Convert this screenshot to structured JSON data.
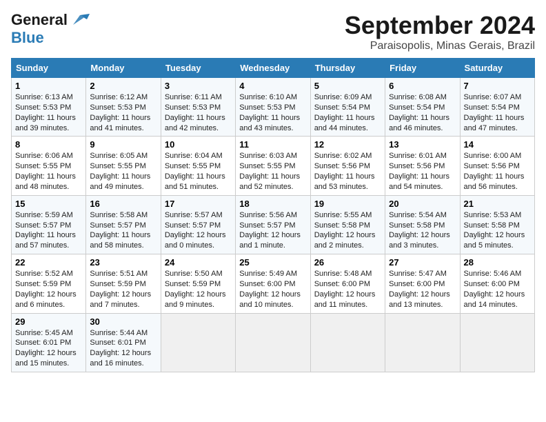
{
  "header": {
    "logo_line1": "General",
    "logo_line2": "Blue",
    "month": "September 2024",
    "location": "Paraisopolis, Minas Gerais, Brazil"
  },
  "weekdays": [
    "Sunday",
    "Monday",
    "Tuesday",
    "Wednesday",
    "Thursday",
    "Friday",
    "Saturday"
  ],
  "weeks": [
    [
      {
        "day": "1",
        "sunrise": "6:13 AM",
        "sunset": "5:53 PM",
        "daylight": "11 hours and 39 minutes."
      },
      {
        "day": "2",
        "sunrise": "6:12 AM",
        "sunset": "5:53 PM",
        "daylight": "11 hours and 41 minutes."
      },
      {
        "day": "3",
        "sunrise": "6:11 AM",
        "sunset": "5:53 PM",
        "daylight": "11 hours and 42 minutes."
      },
      {
        "day": "4",
        "sunrise": "6:10 AM",
        "sunset": "5:53 PM",
        "daylight": "11 hours and 43 minutes."
      },
      {
        "day": "5",
        "sunrise": "6:09 AM",
        "sunset": "5:54 PM",
        "daylight": "11 hours and 44 minutes."
      },
      {
        "day": "6",
        "sunrise": "6:08 AM",
        "sunset": "5:54 PM",
        "daylight": "11 hours and 46 minutes."
      },
      {
        "day": "7",
        "sunrise": "6:07 AM",
        "sunset": "5:54 PM",
        "daylight": "11 hours and 47 minutes."
      }
    ],
    [
      {
        "day": "8",
        "sunrise": "6:06 AM",
        "sunset": "5:55 PM",
        "daylight": "11 hours and 48 minutes."
      },
      {
        "day": "9",
        "sunrise": "6:05 AM",
        "sunset": "5:55 PM",
        "daylight": "11 hours and 49 minutes."
      },
      {
        "day": "10",
        "sunrise": "6:04 AM",
        "sunset": "5:55 PM",
        "daylight": "11 hours and 51 minutes."
      },
      {
        "day": "11",
        "sunrise": "6:03 AM",
        "sunset": "5:55 PM",
        "daylight": "11 hours and 52 minutes."
      },
      {
        "day": "12",
        "sunrise": "6:02 AM",
        "sunset": "5:56 PM",
        "daylight": "11 hours and 53 minutes."
      },
      {
        "day": "13",
        "sunrise": "6:01 AM",
        "sunset": "5:56 PM",
        "daylight": "11 hours and 54 minutes."
      },
      {
        "day": "14",
        "sunrise": "6:00 AM",
        "sunset": "5:56 PM",
        "daylight": "11 hours and 56 minutes."
      }
    ],
    [
      {
        "day": "15",
        "sunrise": "5:59 AM",
        "sunset": "5:57 PM",
        "daylight": "11 hours and 57 minutes."
      },
      {
        "day": "16",
        "sunrise": "5:58 AM",
        "sunset": "5:57 PM",
        "daylight": "11 hours and 58 minutes."
      },
      {
        "day": "17",
        "sunrise": "5:57 AM",
        "sunset": "5:57 PM",
        "daylight": "12 hours and 0 minutes."
      },
      {
        "day": "18",
        "sunrise": "5:56 AM",
        "sunset": "5:57 PM",
        "daylight": "12 hours and 1 minute."
      },
      {
        "day": "19",
        "sunrise": "5:55 AM",
        "sunset": "5:58 PM",
        "daylight": "12 hours and 2 minutes."
      },
      {
        "day": "20",
        "sunrise": "5:54 AM",
        "sunset": "5:58 PM",
        "daylight": "12 hours and 3 minutes."
      },
      {
        "day": "21",
        "sunrise": "5:53 AM",
        "sunset": "5:58 PM",
        "daylight": "12 hours and 5 minutes."
      }
    ],
    [
      {
        "day": "22",
        "sunrise": "5:52 AM",
        "sunset": "5:59 PM",
        "daylight": "12 hours and 6 minutes."
      },
      {
        "day": "23",
        "sunrise": "5:51 AM",
        "sunset": "5:59 PM",
        "daylight": "12 hours and 7 minutes."
      },
      {
        "day": "24",
        "sunrise": "5:50 AM",
        "sunset": "5:59 PM",
        "daylight": "12 hours and 9 minutes."
      },
      {
        "day": "25",
        "sunrise": "5:49 AM",
        "sunset": "6:00 PM",
        "daylight": "12 hours and 10 minutes."
      },
      {
        "day": "26",
        "sunrise": "5:48 AM",
        "sunset": "6:00 PM",
        "daylight": "12 hours and 11 minutes."
      },
      {
        "day": "27",
        "sunrise": "5:47 AM",
        "sunset": "6:00 PM",
        "daylight": "12 hours and 13 minutes."
      },
      {
        "day": "28",
        "sunrise": "5:46 AM",
        "sunset": "6:00 PM",
        "daylight": "12 hours and 14 minutes."
      }
    ],
    [
      {
        "day": "29",
        "sunrise": "5:45 AM",
        "sunset": "6:01 PM",
        "daylight": "12 hours and 15 minutes."
      },
      {
        "day": "30",
        "sunrise": "5:44 AM",
        "sunset": "6:01 PM",
        "daylight": "12 hours and 16 minutes."
      },
      null,
      null,
      null,
      null,
      null
    ]
  ]
}
